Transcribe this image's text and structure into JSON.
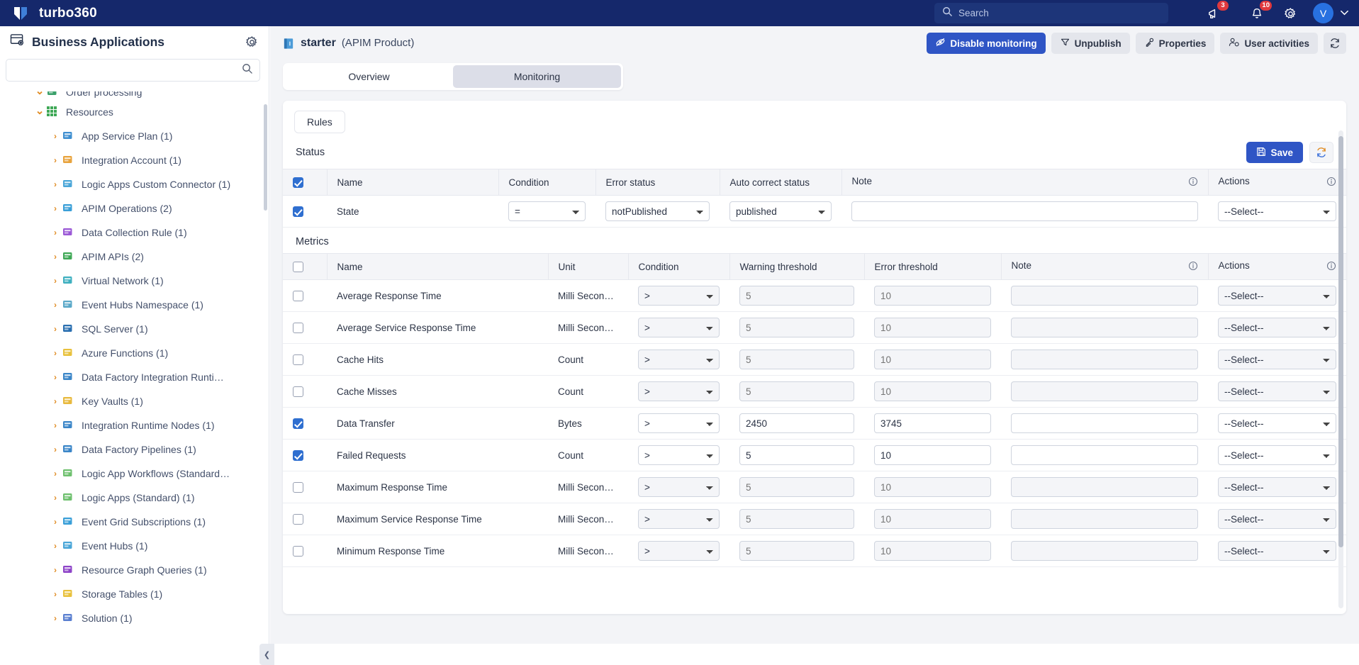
{
  "topbar": {
    "brand": "turbo360",
    "search_placeholder": "Search",
    "announcements_badge": "3",
    "notifications_badge": "10",
    "avatar_initial": "V"
  },
  "sidebar": {
    "title": "Business Applications",
    "search_value": "",
    "items": [
      {
        "label": "Order processing",
        "indent": 1,
        "expanded": true,
        "icon": "flow-icon",
        "partial": true
      },
      {
        "label": "Resources",
        "indent": 1,
        "expanded": true,
        "icon": "grid-icon"
      },
      {
        "label": "App Service Plan (1)",
        "indent": 2,
        "expanded": false,
        "icon": "app-service-plan-icon"
      },
      {
        "label": "Integration Account (1)",
        "indent": 2,
        "expanded": false,
        "icon": "integration-account-icon"
      },
      {
        "label": "Logic Apps Custom Connector (1)",
        "indent": 2,
        "expanded": false,
        "icon": "custom-connector-icon"
      },
      {
        "label": "APIM Operations (2)",
        "indent": 2,
        "expanded": false,
        "icon": "apim-operations-icon"
      },
      {
        "label": "Data Collection Rule (1)",
        "indent": 2,
        "expanded": false,
        "icon": "data-collection-rule-icon"
      },
      {
        "label": "APIM APIs (2)",
        "indent": 2,
        "expanded": false,
        "icon": "apim-apis-icon"
      },
      {
        "label": "Virtual Network (1)",
        "indent": 2,
        "expanded": false,
        "icon": "virtual-network-icon"
      },
      {
        "label": "Event Hubs Namespace (1)",
        "indent": 2,
        "expanded": false,
        "icon": "event-hubs-namespace-icon"
      },
      {
        "label": "SQL Server (1)",
        "indent": 2,
        "expanded": false,
        "icon": "sql-server-icon"
      },
      {
        "label": "Azure Functions (1)",
        "indent": 2,
        "expanded": false,
        "icon": "azure-functions-icon"
      },
      {
        "label": "Data Factory Integration Runti…",
        "indent": 2,
        "expanded": false,
        "icon": "data-factory-icon"
      },
      {
        "label": "Key Vaults (1)",
        "indent": 2,
        "expanded": false,
        "icon": "key-vault-icon"
      },
      {
        "label": "Integration Runtime Nodes (1)",
        "indent": 2,
        "expanded": false,
        "icon": "data-factory-icon"
      },
      {
        "label": "Data Factory Pipelines (1)",
        "indent": 2,
        "expanded": false,
        "icon": "data-factory-icon"
      },
      {
        "label": "Logic App Workflows (Standard…",
        "indent": 2,
        "expanded": false,
        "icon": "logic-app-icon"
      },
      {
        "label": "Logic Apps (Standard) (1)",
        "indent": 2,
        "expanded": false,
        "icon": "logic-app-icon"
      },
      {
        "label": "Event Grid Subscriptions (1)",
        "indent": 2,
        "expanded": false,
        "icon": "event-grid-icon"
      },
      {
        "label": "Event Hubs (1)",
        "indent": 2,
        "expanded": false,
        "icon": "event-hubs-icon"
      },
      {
        "label": "Resource Graph Queries (1)",
        "indent": 2,
        "expanded": false,
        "icon": "resource-graph-icon"
      },
      {
        "label": "Storage Tables (1)",
        "indent": 2,
        "expanded": false,
        "icon": "storage-table-icon"
      },
      {
        "label": "Solution (1)",
        "indent": 2,
        "expanded": false,
        "icon": "solution-icon"
      }
    ]
  },
  "page": {
    "title": "starter",
    "subtitle": "(APIM Product)",
    "toolbar": {
      "disable_monitoring": "Disable monitoring",
      "unpublish": "Unpublish",
      "properties": "Properties",
      "user_activities": "User activities"
    },
    "tabs": [
      {
        "label": "Overview",
        "active": false
      },
      {
        "label": "Monitoring",
        "active": true
      }
    ],
    "rules_chip": "Rules"
  },
  "status_section": {
    "title": "Status",
    "save_label": "Save",
    "header_checkbox_checked": true,
    "columns": [
      "Name",
      "Condition",
      "Error status",
      "Auto correct status",
      "Note",
      "Actions"
    ],
    "rows": [
      {
        "checked": true,
        "name": "State",
        "condition": "=",
        "error_status": "notPublished",
        "auto_correct_status": "published",
        "note": "",
        "action": "--Select--"
      }
    ]
  },
  "metrics_section": {
    "title": "Metrics",
    "header_checkbox_checked": false,
    "columns": [
      "Name",
      "Unit",
      "Condition",
      "Warning threshold",
      "Error threshold",
      "Note",
      "Actions"
    ],
    "default_action": "--Select--",
    "rows": [
      {
        "checked": false,
        "name": "Average Response Time",
        "unit": "Milli Secon…",
        "condition": ">",
        "warning": "5",
        "error": "10",
        "note": "",
        "action": "--Select--"
      },
      {
        "checked": false,
        "name": "Average Service Response Time",
        "unit": "Milli Secon…",
        "condition": ">",
        "warning": "5",
        "error": "10",
        "note": "",
        "action": "--Select--"
      },
      {
        "checked": false,
        "name": "Cache Hits",
        "unit": "Count",
        "condition": ">",
        "warning": "5",
        "error": "10",
        "note": "",
        "action": "--Select--"
      },
      {
        "checked": false,
        "name": "Cache Misses",
        "unit": "Count",
        "condition": ">",
        "warning": "5",
        "error": "10",
        "note": "",
        "action": "--Select--"
      },
      {
        "checked": true,
        "name": "Data Transfer",
        "unit": "Bytes",
        "condition": ">",
        "warning": "2450",
        "error": "3745",
        "note": "",
        "action": "--Select--"
      },
      {
        "checked": true,
        "name": "Failed Requests",
        "unit": "Count",
        "condition": ">",
        "warning": "5",
        "error": "10",
        "note": "",
        "action": "--Select--"
      },
      {
        "checked": false,
        "name": "Maximum Response Time",
        "unit": "Milli Secon…",
        "condition": ">",
        "warning": "5",
        "error": "10",
        "note": "",
        "action": "--Select--"
      },
      {
        "checked": false,
        "name": "Maximum Service Response Time",
        "unit": "Milli Secon…",
        "condition": ">",
        "warning": "5",
        "error": "10",
        "note": "",
        "action": "--Select--"
      },
      {
        "checked": false,
        "name": "Minimum Response Time",
        "unit": "Milli Secon…",
        "condition": ">",
        "warning": "5",
        "error": "10",
        "note": "",
        "action": "--Select--"
      }
    ]
  },
  "colors": {
    "brand_navy": "#15286b",
    "accent_blue": "#2f55c5",
    "badge_red": "#e0393e",
    "chevron_orange": "#e08c24"
  }
}
